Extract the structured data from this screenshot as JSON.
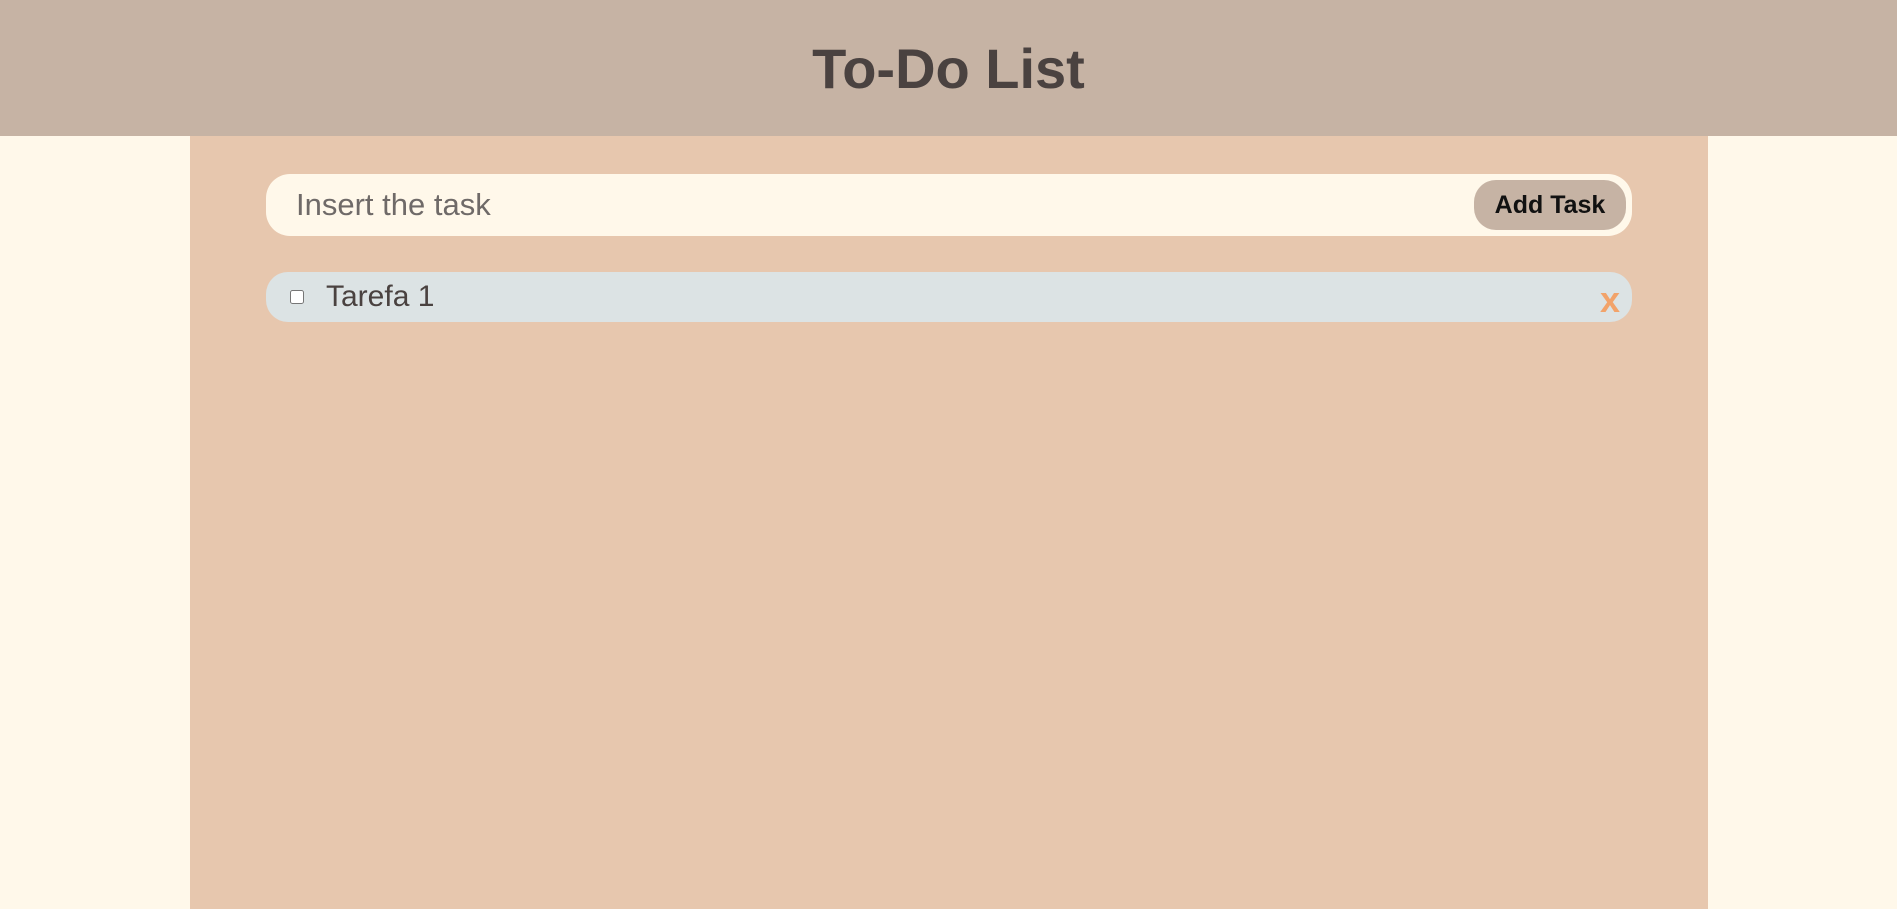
{
  "header": {
    "title": "To-Do List"
  },
  "add_task": {
    "placeholder": "Insert the task",
    "value": "",
    "button_label": "Add Task"
  },
  "tasks": [
    {
      "label": "Tarefa 1",
      "checked": false,
      "delete_label": "x"
    }
  ],
  "colors": {
    "page_background": "#fff8ea",
    "header_background": "#c6b3a4",
    "main_background": "#e7c7ae",
    "task_background": "#dce3e4",
    "delete_accent": "#f2a36a",
    "text": "#4a4240"
  }
}
